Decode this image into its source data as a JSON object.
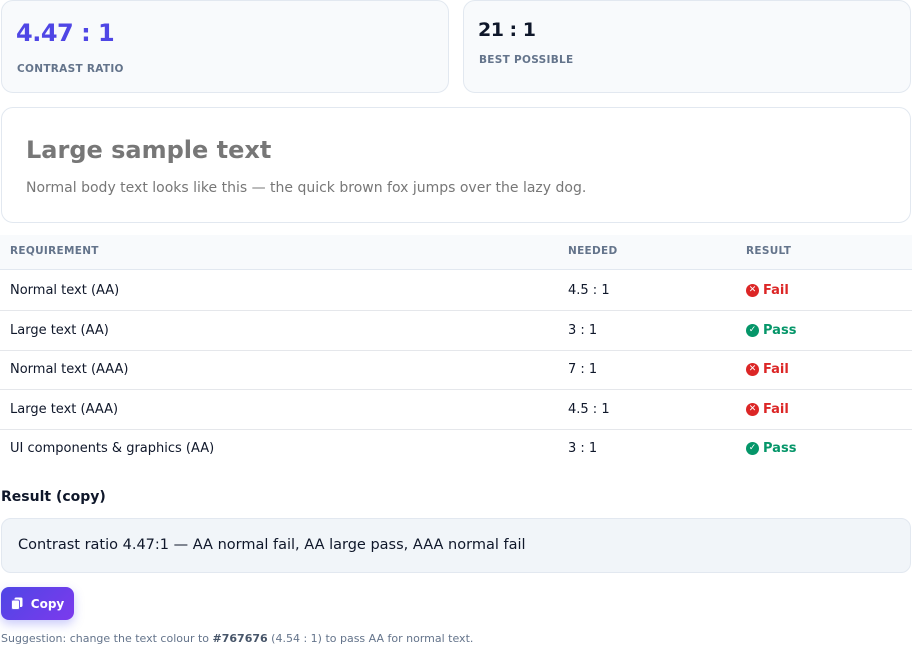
{
  "stats": {
    "ratio_value": "4.47 : 1",
    "ratio_label": "CONTRAST RATIO",
    "best_value": "21 : 1",
    "best_label": "BEST POSSIBLE"
  },
  "preview": {
    "large_text": "Large sample text",
    "body_text": "Normal body text looks like this — the quick brown fox jumps over the lazy dog.",
    "text_color": "#777777"
  },
  "table": {
    "headers": {
      "requirement": "REQUIREMENT",
      "needed": "NEEDED",
      "result": "RESULT"
    },
    "rows": [
      {
        "requirement": "Normal text (AA)",
        "needed": "4.5 : 1",
        "result": "Fail"
      },
      {
        "requirement": "Large text (AA)",
        "needed": "3 : 1",
        "result": "Pass"
      },
      {
        "requirement": "Normal text (AAA)",
        "needed": "7 : 1",
        "result": "Fail"
      },
      {
        "requirement": "Large text (AAA)",
        "needed": "4.5 : 1",
        "result": "Fail"
      },
      {
        "requirement": "UI components & graphics (AA)",
        "needed": "3 : 1",
        "result": "Pass"
      }
    ]
  },
  "result": {
    "title": "Result (copy)",
    "text": "Contrast ratio 4.47:1 — AA normal fail, AA large pass, AAA normal fail"
  },
  "copy_button": {
    "label": "Copy"
  },
  "suggestion": {
    "prefix": "Suggestion: change the text colour to ",
    "color": "#767676",
    "suffix": " (4.54 : 1) to pass AA for normal text."
  },
  "colors": {
    "accent": "#4f46e5",
    "fail": "#dc2626",
    "pass": "#059669"
  },
  "icons": {
    "fail": "x-circle-icon",
    "pass": "check-circle-icon",
    "copy": "copy-icon"
  }
}
